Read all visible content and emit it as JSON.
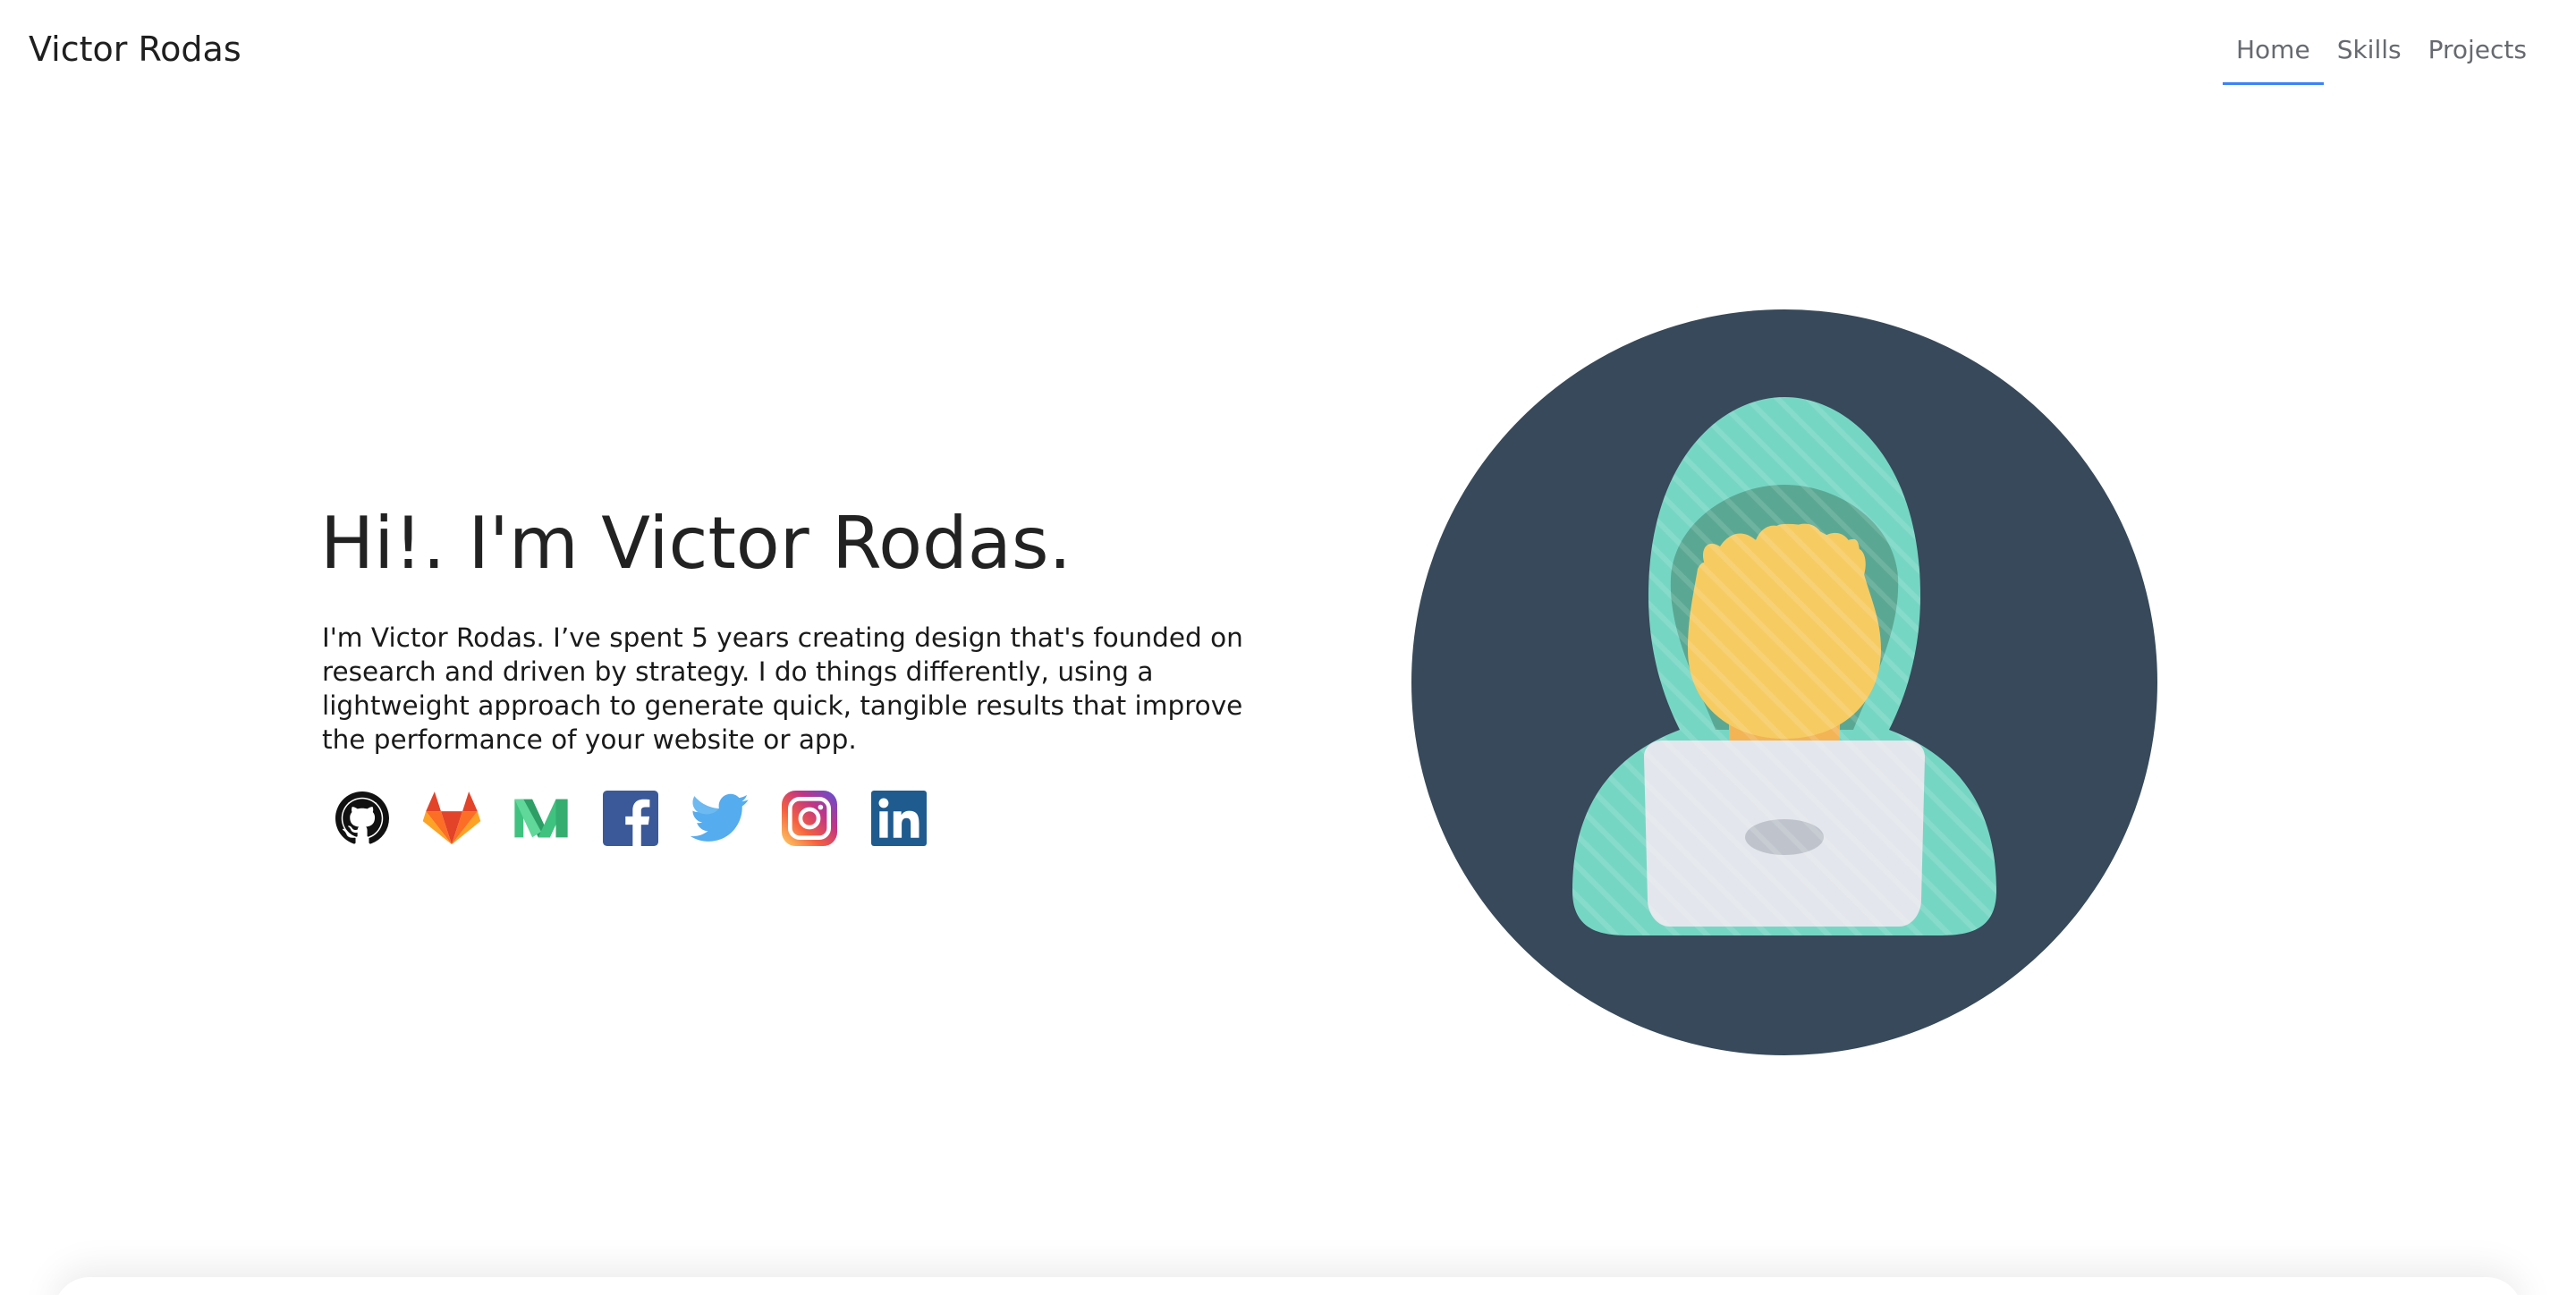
{
  "header": {
    "brand": "Victor Rodas",
    "nav": [
      {
        "label": "Home",
        "active": true
      },
      {
        "label": "Skills",
        "active": false
      },
      {
        "label": "Projects",
        "active": false
      }
    ]
  },
  "hero": {
    "title": "Hi!. I'm Victor Rodas.",
    "description": "I'm Victor Rodas. I’ve spent 5 years creating design that's founded on research and driven by strategy. I do things differently, using a lightweight approach to generate quick, tangible results that improve the performance of your website or app."
  },
  "socials": [
    {
      "name": "github",
      "icon": "github-icon"
    },
    {
      "name": "gitlab",
      "icon": "gitlab-icon"
    },
    {
      "name": "medium",
      "icon": "medium-icon"
    },
    {
      "name": "facebook",
      "icon": "facebook-icon"
    },
    {
      "name": "twitter",
      "icon": "twitter-icon"
    },
    {
      "name": "instagram",
      "icon": "instagram-icon"
    },
    {
      "name": "linkedin",
      "icon": "linkedin-icon"
    }
  ],
  "colors": {
    "nav_active_underline": "#3b82f6",
    "avatar_background": "#37495a",
    "hood": "#76d6c4",
    "face": "#f6cb62",
    "laptop": "#e3e6ec"
  }
}
